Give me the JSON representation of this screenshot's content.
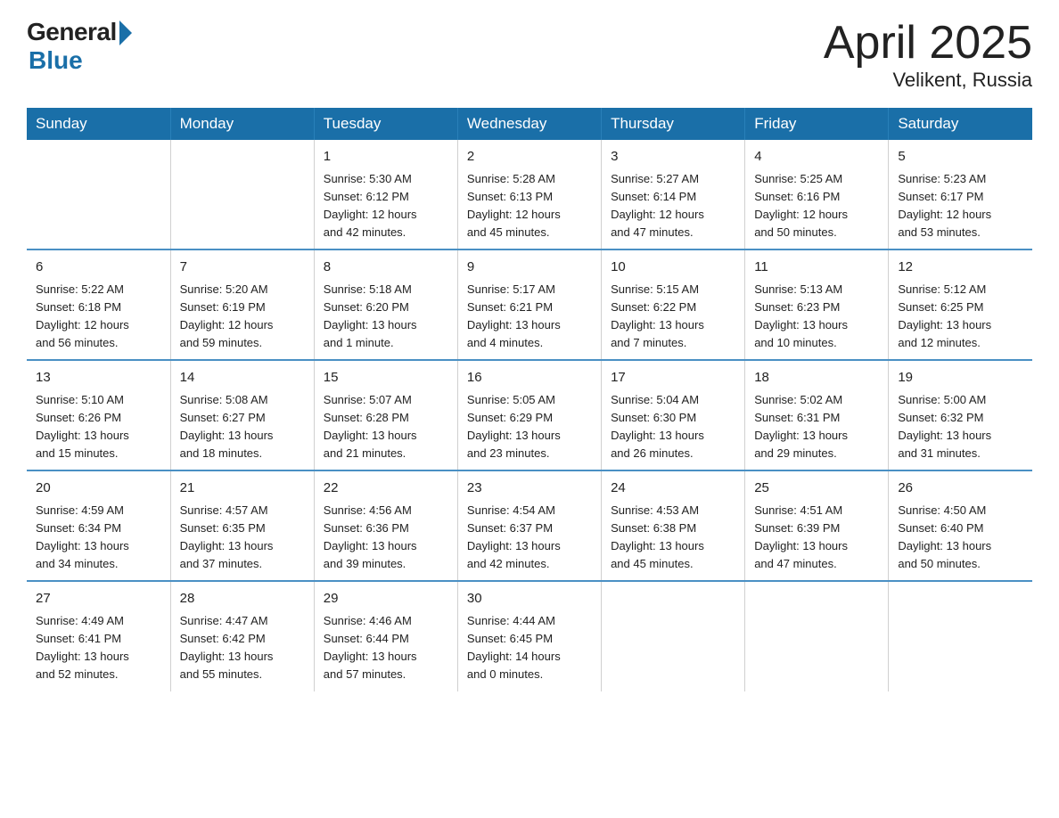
{
  "logo": {
    "general": "General",
    "blue": "Blue"
  },
  "header": {
    "month": "April 2025",
    "location": "Velikent, Russia"
  },
  "weekdays": [
    "Sunday",
    "Monday",
    "Tuesday",
    "Wednesday",
    "Thursday",
    "Friday",
    "Saturday"
  ],
  "weeks": [
    [
      {
        "day": "",
        "info": ""
      },
      {
        "day": "",
        "info": ""
      },
      {
        "day": "1",
        "info": "Sunrise: 5:30 AM\nSunset: 6:12 PM\nDaylight: 12 hours\nand 42 minutes."
      },
      {
        "day": "2",
        "info": "Sunrise: 5:28 AM\nSunset: 6:13 PM\nDaylight: 12 hours\nand 45 minutes."
      },
      {
        "day": "3",
        "info": "Sunrise: 5:27 AM\nSunset: 6:14 PM\nDaylight: 12 hours\nand 47 minutes."
      },
      {
        "day": "4",
        "info": "Sunrise: 5:25 AM\nSunset: 6:16 PM\nDaylight: 12 hours\nand 50 minutes."
      },
      {
        "day": "5",
        "info": "Sunrise: 5:23 AM\nSunset: 6:17 PM\nDaylight: 12 hours\nand 53 minutes."
      }
    ],
    [
      {
        "day": "6",
        "info": "Sunrise: 5:22 AM\nSunset: 6:18 PM\nDaylight: 12 hours\nand 56 minutes."
      },
      {
        "day": "7",
        "info": "Sunrise: 5:20 AM\nSunset: 6:19 PM\nDaylight: 12 hours\nand 59 minutes."
      },
      {
        "day": "8",
        "info": "Sunrise: 5:18 AM\nSunset: 6:20 PM\nDaylight: 13 hours\nand 1 minute."
      },
      {
        "day": "9",
        "info": "Sunrise: 5:17 AM\nSunset: 6:21 PM\nDaylight: 13 hours\nand 4 minutes."
      },
      {
        "day": "10",
        "info": "Sunrise: 5:15 AM\nSunset: 6:22 PM\nDaylight: 13 hours\nand 7 minutes."
      },
      {
        "day": "11",
        "info": "Sunrise: 5:13 AM\nSunset: 6:23 PM\nDaylight: 13 hours\nand 10 minutes."
      },
      {
        "day": "12",
        "info": "Sunrise: 5:12 AM\nSunset: 6:25 PM\nDaylight: 13 hours\nand 12 minutes."
      }
    ],
    [
      {
        "day": "13",
        "info": "Sunrise: 5:10 AM\nSunset: 6:26 PM\nDaylight: 13 hours\nand 15 minutes."
      },
      {
        "day": "14",
        "info": "Sunrise: 5:08 AM\nSunset: 6:27 PM\nDaylight: 13 hours\nand 18 minutes."
      },
      {
        "day": "15",
        "info": "Sunrise: 5:07 AM\nSunset: 6:28 PM\nDaylight: 13 hours\nand 21 minutes."
      },
      {
        "day": "16",
        "info": "Sunrise: 5:05 AM\nSunset: 6:29 PM\nDaylight: 13 hours\nand 23 minutes."
      },
      {
        "day": "17",
        "info": "Sunrise: 5:04 AM\nSunset: 6:30 PM\nDaylight: 13 hours\nand 26 minutes."
      },
      {
        "day": "18",
        "info": "Sunrise: 5:02 AM\nSunset: 6:31 PM\nDaylight: 13 hours\nand 29 minutes."
      },
      {
        "day": "19",
        "info": "Sunrise: 5:00 AM\nSunset: 6:32 PM\nDaylight: 13 hours\nand 31 minutes."
      }
    ],
    [
      {
        "day": "20",
        "info": "Sunrise: 4:59 AM\nSunset: 6:34 PM\nDaylight: 13 hours\nand 34 minutes."
      },
      {
        "day": "21",
        "info": "Sunrise: 4:57 AM\nSunset: 6:35 PM\nDaylight: 13 hours\nand 37 minutes."
      },
      {
        "day": "22",
        "info": "Sunrise: 4:56 AM\nSunset: 6:36 PM\nDaylight: 13 hours\nand 39 minutes."
      },
      {
        "day": "23",
        "info": "Sunrise: 4:54 AM\nSunset: 6:37 PM\nDaylight: 13 hours\nand 42 minutes."
      },
      {
        "day": "24",
        "info": "Sunrise: 4:53 AM\nSunset: 6:38 PM\nDaylight: 13 hours\nand 45 minutes."
      },
      {
        "day": "25",
        "info": "Sunrise: 4:51 AM\nSunset: 6:39 PM\nDaylight: 13 hours\nand 47 minutes."
      },
      {
        "day": "26",
        "info": "Sunrise: 4:50 AM\nSunset: 6:40 PM\nDaylight: 13 hours\nand 50 minutes."
      }
    ],
    [
      {
        "day": "27",
        "info": "Sunrise: 4:49 AM\nSunset: 6:41 PM\nDaylight: 13 hours\nand 52 minutes."
      },
      {
        "day": "28",
        "info": "Sunrise: 4:47 AM\nSunset: 6:42 PM\nDaylight: 13 hours\nand 55 minutes."
      },
      {
        "day": "29",
        "info": "Sunrise: 4:46 AM\nSunset: 6:44 PM\nDaylight: 13 hours\nand 57 minutes."
      },
      {
        "day": "30",
        "info": "Sunrise: 4:44 AM\nSunset: 6:45 PM\nDaylight: 14 hours\nand 0 minutes."
      },
      {
        "day": "",
        "info": ""
      },
      {
        "day": "",
        "info": ""
      },
      {
        "day": "",
        "info": ""
      }
    ]
  ]
}
